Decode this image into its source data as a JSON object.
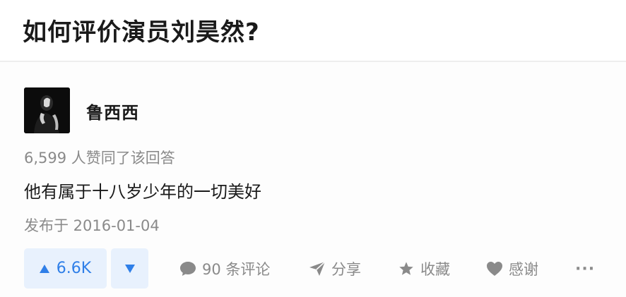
{
  "question": {
    "title": "如何评价演员刘昊然?"
  },
  "answer": {
    "author_name": "鲁西西",
    "upvote_summary": "6,599 人赞同了该回答",
    "content": "他有属于十八岁少年的一切美好",
    "published": "发布于 2016-01-04"
  },
  "actions": {
    "upvote_count": "6.6K",
    "comments": "90 条评论",
    "share": "分享",
    "collect": "收藏",
    "thanks": "感谢",
    "more": "···"
  },
  "colors": {
    "accent": "#2f7fe8",
    "accent_bg": "#e8f1fd",
    "muted": "#8a8a8a",
    "text": "#1a1a1a"
  },
  "icons": [
    "upvote-triangle-icon",
    "downvote-triangle-icon",
    "comment-bubble-icon",
    "share-arrow-icon",
    "star-icon",
    "heart-icon",
    "more-dots-icon"
  ]
}
